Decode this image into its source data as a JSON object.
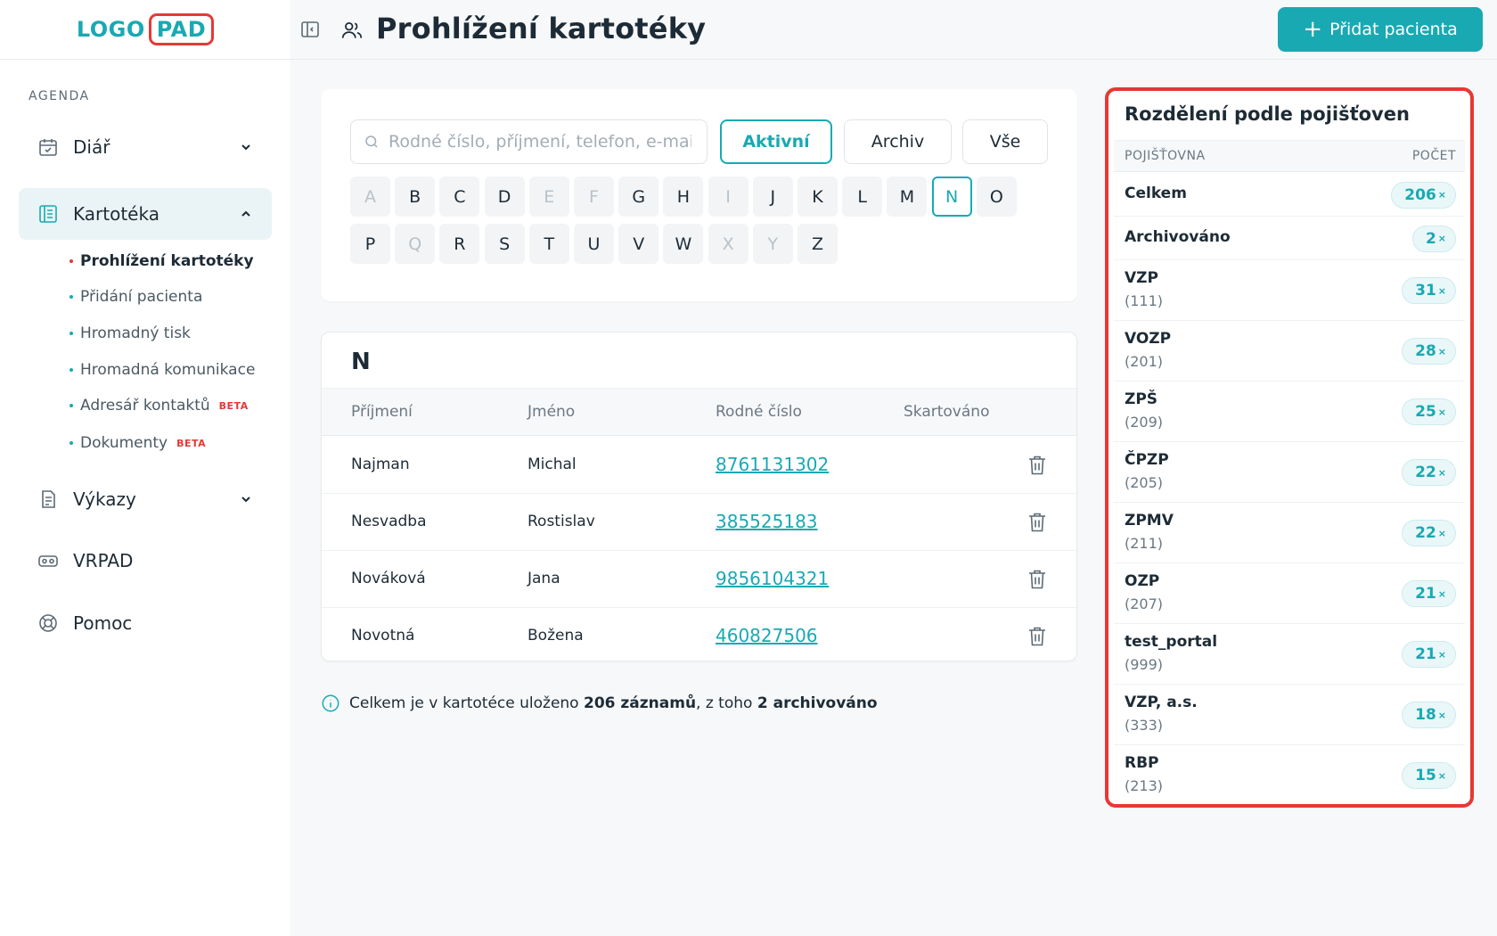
{
  "logo": {
    "part1": "LOGO",
    "part2": "PAD"
  },
  "sidebar": {
    "section_label": "AGENDA",
    "items": [
      {
        "label": "Diář",
        "icon": "calendar-icon"
      },
      {
        "label": "Kartotéka",
        "icon": "card-file-icon"
      },
      {
        "label": "Výkazy",
        "icon": "report-icon"
      },
      {
        "label": "VRPAD",
        "icon": "vr-headset-icon"
      },
      {
        "label": "Pomoc",
        "icon": "lifebuoy-icon"
      }
    ],
    "subitems": [
      {
        "label": "Prohlížení kartotéky"
      },
      {
        "label": "Přidání pacienta"
      },
      {
        "label": "Hromadný tisk"
      },
      {
        "label": "Hromadná komunikace"
      },
      {
        "label": "Adresář kontaktů",
        "badge": "BETA"
      },
      {
        "label": "Dokumenty",
        "badge": "BETA"
      }
    ]
  },
  "header": {
    "title": "Prohlížení kartotéky",
    "add_button": "Přidat pacienta",
    "add_plus": "+"
  },
  "filter": {
    "search_placeholder": "Rodné číslo, příjmení, telefon, e-mail",
    "buttons": [
      "Aktivní",
      "Archiv",
      "Vše"
    ],
    "active_button": "Aktivní",
    "letters_row1": [
      "A",
      "B",
      "C",
      "D",
      "E",
      "F",
      "G",
      "H",
      "I",
      "J",
      "K",
      "L",
      "M",
      "N",
      "O"
    ],
    "letters_row2": [
      "P",
      "Q",
      "R",
      "S",
      "T",
      "U",
      "V",
      "W",
      "X",
      "Y",
      "Z"
    ],
    "disabled_letters": [
      "A",
      "E",
      "F",
      "I",
      "Q",
      "X",
      "Y"
    ],
    "active_letter": "N"
  },
  "table": {
    "group_letter": "N",
    "headers": [
      "Příjmení",
      "Jméno",
      "Rodné číslo",
      "Skartováno"
    ],
    "rows": [
      {
        "surname": "Najman",
        "name": "Michal",
        "birth_number": "8761131302"
      },
      {
        "surname": "Nesvadba",
        "name": "Rostislav",
        "birth_number": "385525183"
      },
      {
        "surname": "Nováková",
        "name": "Jana",
        "birth_number": "9856104321"
      },
      {
        "surname": "Novotná",
        "name": "Božena",
        "birth_number": "460827506"
      }
    ]
  },
  "info": {
    "prefix": "Celkem je v kartotéce uloženo ",
    "count": "206 záznamů",
    "middle": ", z toho ",
    "archived": "2 archivováno"
  },
  "insurance": {
    "title": "Rozdělení podle pojišťoven",
    "header_name": "POJIŠŤOVNA",
    "header_count": "POČET",
    "multiplier": "×",
    "rows": [
      {
        "name": "Celkem",
        "count": "206"
      },
      {
        "name": "Archivováno",
        "count": "2"
      },
      {
        "name": "VZP",
        "code": "(111)",
        "count": "31"
      },
      {
        "name": "VOZP",
        "code": "(201)",
        "count": "28"
      },
      {
        "name": "ZPŠ",
        "code": "(209)",
        "count": "25"
      },
      {
        "name": "ČPZP",
        "code": "(205)",
        "count": "22"
      },
      {
        "name": "ZPMV",
        "code": "(211)",
        "count": "22"
      },
      {
        "name": "OZP",
        "code": "(207)",
        "count": "21"
      },
      {
        "name": "test_portal",
        "code": "(999)",
        "count": "21"
      },
      {
        "name": "VZP, a.s.",
        "code": "(333)",
        "count": "18"
      },
      {
        "name": "RBP",
        "code": "(213)",
        "count": "15"
      }
    ]
  },
  "colors": {
    "accent": "#19a9b3",
    "highlight": "#e53935",
    "text": "#1d2b36"
  }
}
